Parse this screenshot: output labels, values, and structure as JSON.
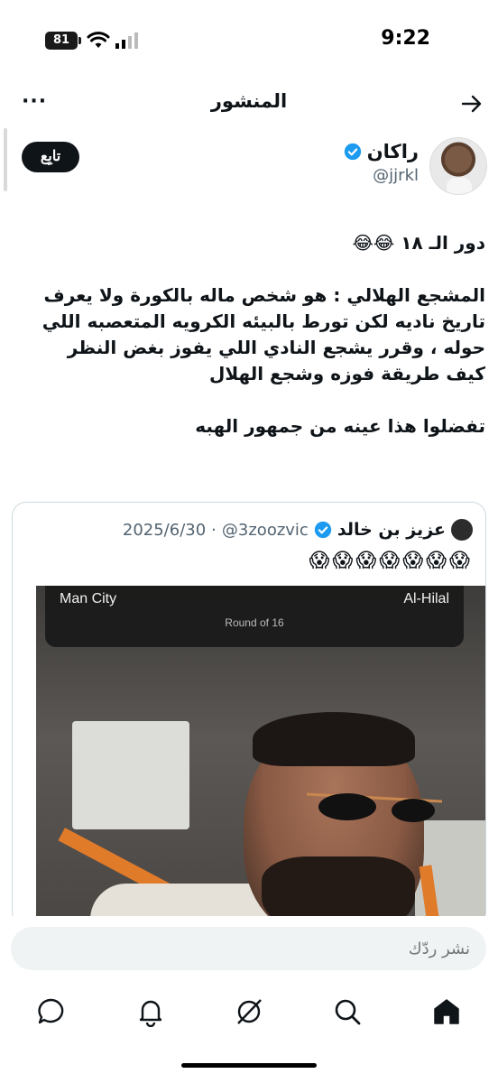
{
  "status_bar": {
    "time": "9:22",
    "battery": "81"
  },
  "nav": {
    "title": "المنشور",
    "more": "···"
  },
  "post": {
    "author_name": "راكان",
    "author_handle": "@jjrkl",
    "follow_label": "تابِع",
    "paragraphs": [
      "دور الـ ١٨ 😂😂",
      "المشجع الهلالي : هو شخص ماله بالكورة ولا يعرف تاريخ ناديه لكن تورط بالبيئه الكرويه المتعصبه اللي  حوله ، وقرر يشجع النادي اللي يفوز بغض النظر كيف طريقة فوزه وشجع الهلال",
      "تفضلوا هذا عينه من جمهور الهبه"
    ]
  },
  "quote": {
    "name": "عزيز بن خالد",
    "handle": "@3zoozvic",
    "separator": "·",
    "date": "2025/6/30",
    "emojis": "😱😱😱😱😱😱😱",
    "video": {
      "team_left": "Man City",
      "team_right": "Al-Hilal",
      "round": "Round of 16"
    }
  },
  "reply": {
    "placeholder": "نشر ردّك"
  },
  "tabs": [
    "home",
    "search",
    "grok",
    "notifications",
    "messages"
  ],
  "colors": {
    "verified": "#1d9bf0",
    "text": "#0f1419",
    "muted": "#536471"
  }
}
